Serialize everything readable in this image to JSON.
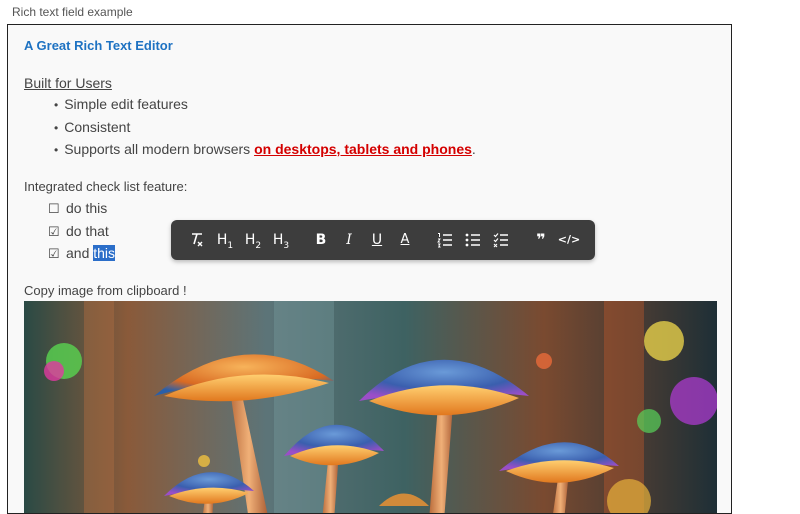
{
  "field_label": "Rich text field example",
  "editor": {
    "heading": "A Great Rich Text Editor",
    "section_title": "Built for Users",
    "bullets": [
      "Simple edit features",
      "Consistent",
      "Supports all modern browsers "
    ],
    "bullet_link": "on desktops, tablets and phones",
    "bullet_end": ".",
    "checklist_title": "Integrated check list feature:",
    "checklist": [
      {
        "text": "do this",
        "checked": false
      },
      {
        "text": "do that",
        "checked": true
      },
      {
        "text_prefix": "and ",
        "text_selected": "this",
        "checked": true
      }
    ],
    "checkbox_unchecked": "☐",
    "checkbox_checked": "☑",
    "clipboard_title": "Copy image from clipboard !",
    "image_label": "mushrooms"
  },
  "toolbar": {
    "h1": "H",
    "h2": "H",
    "h3": "H",
    "h1_sub": "1",
    "h2_sub": "2",
    "h3_sub": "3",
    "bold": "B",
    "italic": "I",
    "underline": "U",
    "text_color": "A",
    "quote": "❞",
    "code": "</>"
  },
  "colors": {
    "accent": "#1e72c2",
    "link_red": "#d40000",
    "toolbar_bg": "#3d3d3d",
    "selection": "#2b6ec9"
  }
}
